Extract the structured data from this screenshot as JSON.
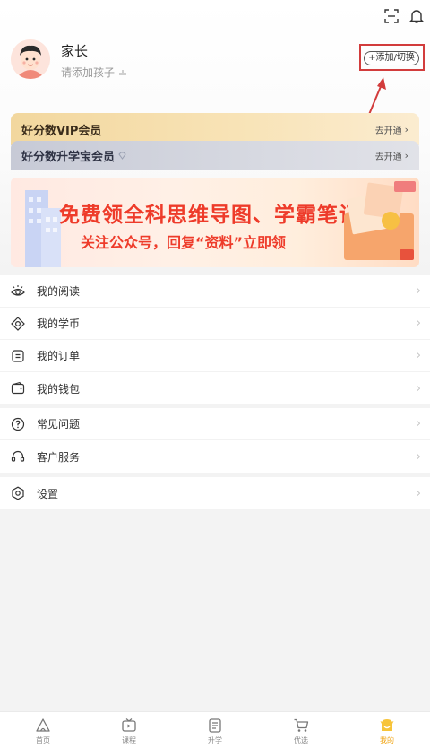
{
  "header": {
    "scan_icon": "scan-icon",
    "bell_icon": "bell-icon"
  },
  "profile": {
    "name": "家长",
    "subtitle": "请添加孩子",
    "add_switch_label": "+添加/切换"
  },
  "vip_cards": [
    {
      "title": "好分数VIP会员",
      "action": "去开通"
    },
    {
      "title": "好分数升学宝会员",
      "action": "去开通"
    }
  ],
  "banner": {
    "title": "免费领全科思维导图、学霸笔记",
    "subtitle": "关注公众号，回复“资料”立即领"
  },
  "menu_group_1": [
    {
      "label": "我的阅读",
      "icon": "eye-icon"
    },
    {
      "label": "我的学币",
      "icon": "coin-icon"
    },
    {
      "label": "我的订单",
      "icon": "order-icon"
    },
    {
      "label": "我的钱包",
      "icon": "wallet-icon"
    }
  ],
  "menu_group_2": [
    {
      "label": "常见问题",
      "icon": "question-icon"
    },
    {
      "label": "客户服务",
      "icon": "headset-icon"
    }
  ],
  "menu_group_3": [
    {
      "label": "设置",
      "icon": "settings-icon"
    }
  ],
  "bottom_nav": [
    {
      "label": "首页",
      "icon": "home-icon",
      "active": false
    },
    {
      "label": "课程",
      "icon": "course-icon",
      "active": false
    },
    {
      "label": "升学",
      "icon": "school-icon",
      "active": false
    },
    {
      "label": "优选",
      "icon": "cart-icon",
      "active": false
    },
    {
      "label": "我的",
      "icon": "profile-icon",
      "active": true
    }
  ],
  "colors": {
    "accent": "#f0a515",
    "annotation_red": "#d23c3c",
    "banner_red": "#ee3b2a"
  }
}
